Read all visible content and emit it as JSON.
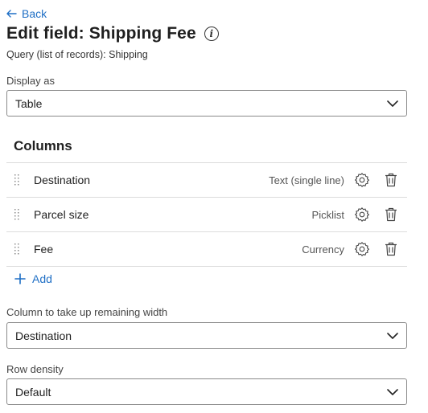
{
  "header": {
    "back_label": "Back",
    "title": "Edit field: Shipping Fee",
    "subtitle": "Query (list of records): Shipping"
  },
  "display_as": {
    "label": "Display as",
    "value": "Table"
  },
  "columns": {
    "title": "Columns",
    "items": [
      {
        "name": "Destination",
        "type": "Text (single line)"
      },
      {
        "name": "Parcel size",
        "type": "Picklist"
      },
      {
        "name": "Fee",
        "type": "Currency"
      }
    ],
    "add_label": "Add"
  },
  "remaining_width": {
    "label": "Column to take up remaining width",
    "value": "Destination"
  },
  "row_density": {
    "label": "Row density",
    "value": "Default"
  },
  "colors": {
    "accent": "#1f6fc5",
    "border": "#8a8a8a",
    "divider": "#dcdcdc"
  }
}
